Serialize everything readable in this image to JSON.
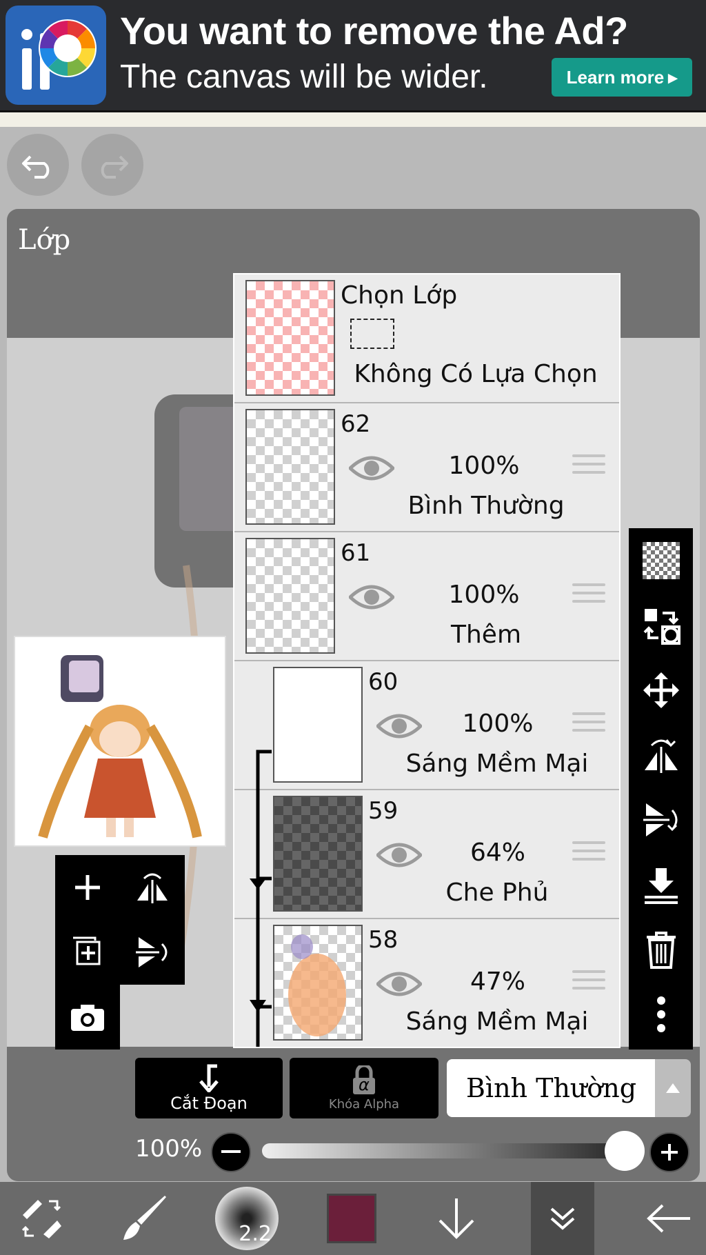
{
  "ad": {
    "title": "You want to remove the Ad?",
    "subtitle": "The canvas will be wider.",
    "button": "Learn more"
  },
  "panel": {
    "title": "Lớp"
  },
  "selection_layer": {
    "title": "Chọn Lớp",
    "status": "Không Có Lựa Chọn"
  },
  "layers": [
    {
      "number": "62",
      "opacity": "100%",
      "mode": "Bình Thường"
    },
    {
      "number": "61",
      "opacity": "100%",
      "mode": "Thêm"
    },
    {
      "number": "60",
      "opacity": "100%",
      "mode": "Sáng Mềm Mại"
    },
    {
      "number": "59",
      "opacity": "64%",
      "mode": "Che Phủ"
    },
    {
      "number": "58",
      "opacity": "47%",
      "mode": "Sáng Mềm Mại"
    }
  ],
  "controls": {
    "clipping_label": "Cắt Đoạn",
    "alpha_lock_label": "Khóa Alpha",
    "alpha_symbol": "α",
    "blend_mode": "Bình Thường",
    "opacity_label": "100%",
    "opacity_value": 1.0
  },
  "bottom_bar": {
    "brush_size": "2.2",
    "color": "#6b1f3a"
  },
  "colors": {
    "ad_button": "#159a8a",
    "panel_bg": "#727272",
    "toolbar_bg": "#000000"
  }
}
